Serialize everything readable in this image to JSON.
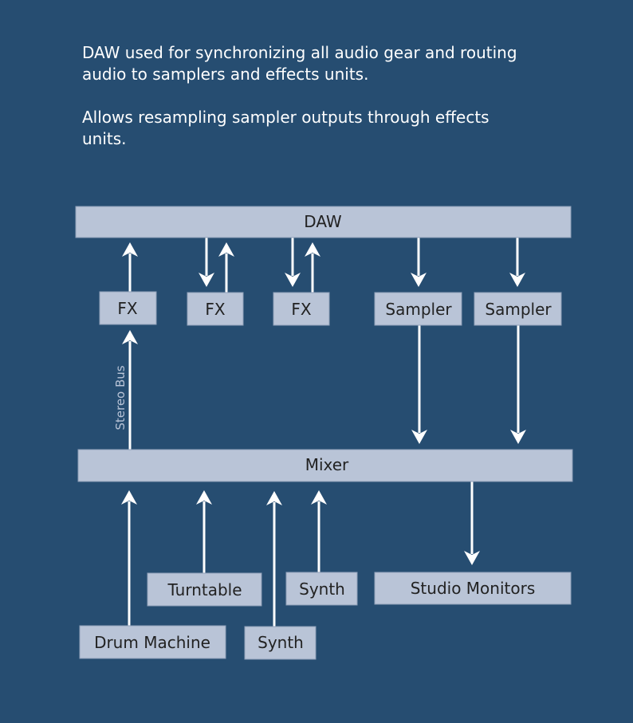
{
  "description": {
    "paragraph_1": "DAW used for synchronizing all audio gear and routing audio to samplers and effects units.",
    "paragraph_2": "Allows resampling sampler outputs through effects units."
  },
  "colors": {
    "background": "#264d71",
    "node_fill": "#b9c4d7",
    "node_text": "#222222",
    "arrow": "#ffffff"
  },
  "nodes": {
    "daw": "DAW",
    "fx_1": "FX",
    "fx_2": "FX",
    "fx_3": "FX",
    "sampler_1": "Sampler",
    "sampler_2": "Sampler",
    "mixer": "Mixer",
    "turntable": "Turntable",
    "synth_1": "Synth",
    "synth_2": "Synth",
    "drum_machine": "Drum Machine",
    "studio_monitors": "Studio Monitors"
  },
  "edges": [
    {
      "from": "fx_1",
      "to": "daw"
    },
    {
      "from": "daw",
      "to": "fx_2"
    },
    {
      "from": "fx_2",
      "to": "daw"
    },
    {
      "from": "daw",
      "to": "fx_3"
    },
    {
      "from": "fx_3",
      "to": "daw"
    },
    {
      "from": "daw",
      "to": "sampler_1"
    },
    {
      "from": "daw",
      "to": "sampler_2"
    },
    {
      "from": "mixer",
      "to": "fx_1",
      "label": "Stereo Bus"
    },
    {
      "from": "sampler_1",
      "to": "mixer"
    },
    {
      "from": "sampler_2",
      "to": "mixer"
    },
    {
      "from": "drum_machine",
      "to": "mixer"
    },
    {
      "from": "turntable",
      "to": "mixer"
    },
    {
      "from": "synth_2",
      "to": "mixer"
    },
    {
      "from": "synth_1",
      "to": "mixer"
    },
    {
      "from": "mixer",
      "to": "studio_monitors"
    }
  ]
}
